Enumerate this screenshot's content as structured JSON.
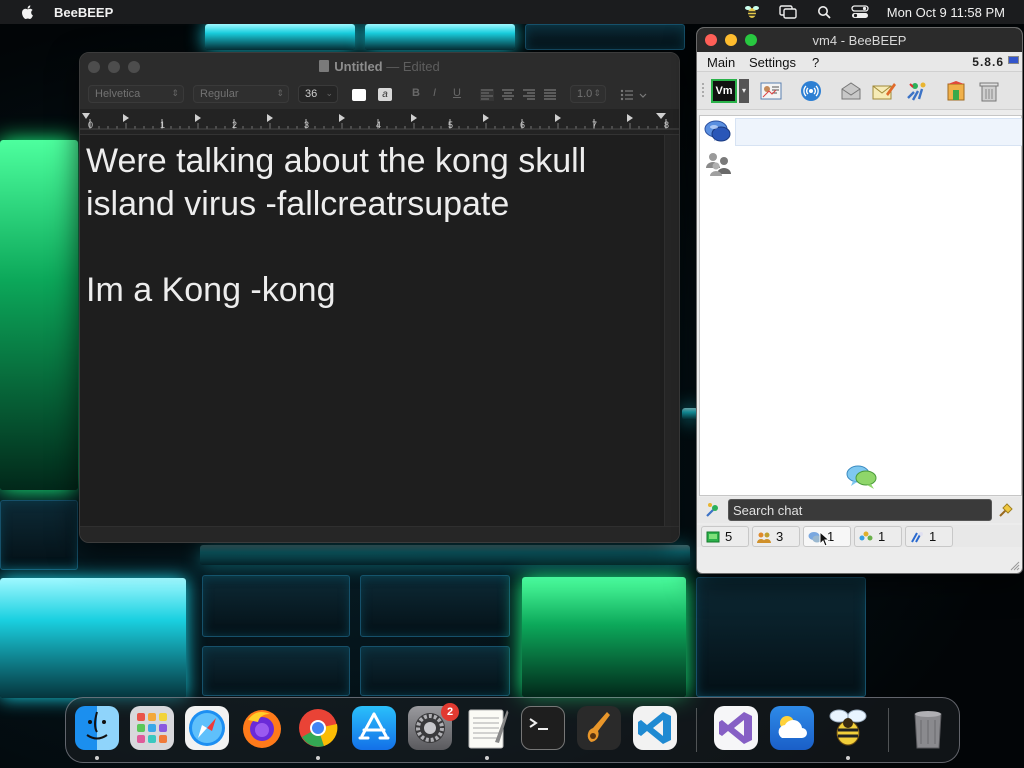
{
  "menubar": {
    "app_name": "BeeBEEP",
    "clock": "Mon Oct 9  11:58 PM",
    "status_icons": [
      "beebeep-status-icon",
      "screen-mirroring-icon",
      "spotlight-search-icon",
      "control-center-icon"
    ]
  },
  "textedit": {
    "title": "Untitled",
    "separator": "—",
    "edited": "Edited",
    "toolbar": {
      "font_family": "Helvetica",
      "font_style": "Regular",
      "font_size": "36",
      "line_spacing": "1.0"
    },
    "ruler_labels": [
      "0",
      "1",
      "2",
      "3",
      "4",
      "5",
      "6",
      "7",
      "8"
    ],
    "lines": [
      "Were talking about the kong skull",
      "island virus -fallcreatrsupate",
      "",
      "Im a Kong -kong"
    ]
  },
  "beebeep": {
    "title": "vm4 - BeeBEEP",
    "menu": {
      "main": "Main",
      "settings": "Settings",
      "help": "?"
    },
    "version": "5.8.6",
    "toolbar_button_label": "Vm",
    "search_placeholder": "Search chat",
    "tabs": [
      {
        "count": "5",
        "icon": "users-online-icon"
      },
      {
        "count": "3",
        "icon": "groups-icon"
      },
      {
        "count": "1",
        "icon": "chats-icon"
      },
      {
        "count": "1",
        "icon": "group-chats-icon"
      },
      {
        "count": "1",
        "icon": "shared-files-icon"
      }
    ]
  },
  "dock": {
    "apps": [
      "Finder",
      "Launchpad",
      "Safari",
      "Firefox",
      "Chrome",
      "App Store",
      "System Settings",
      "TextEdit",
      "Terminal",
      "GarageBand",
      "Visual Studio Code",
      "Visual Studio",
      "Weather",
      "BeeBEEP",
      "Trash"
    ],
    "system_settings_badge": "2"
  },
  "colors": {
    "menubar_bg": "#1b1c1e",
    "textedit_bg": "#1e1e1e",
    "close_red": "#ff5f57",
    "minimize_yellow": "#febc2e",
    "zoom_green": "#28c840"
  }
}
